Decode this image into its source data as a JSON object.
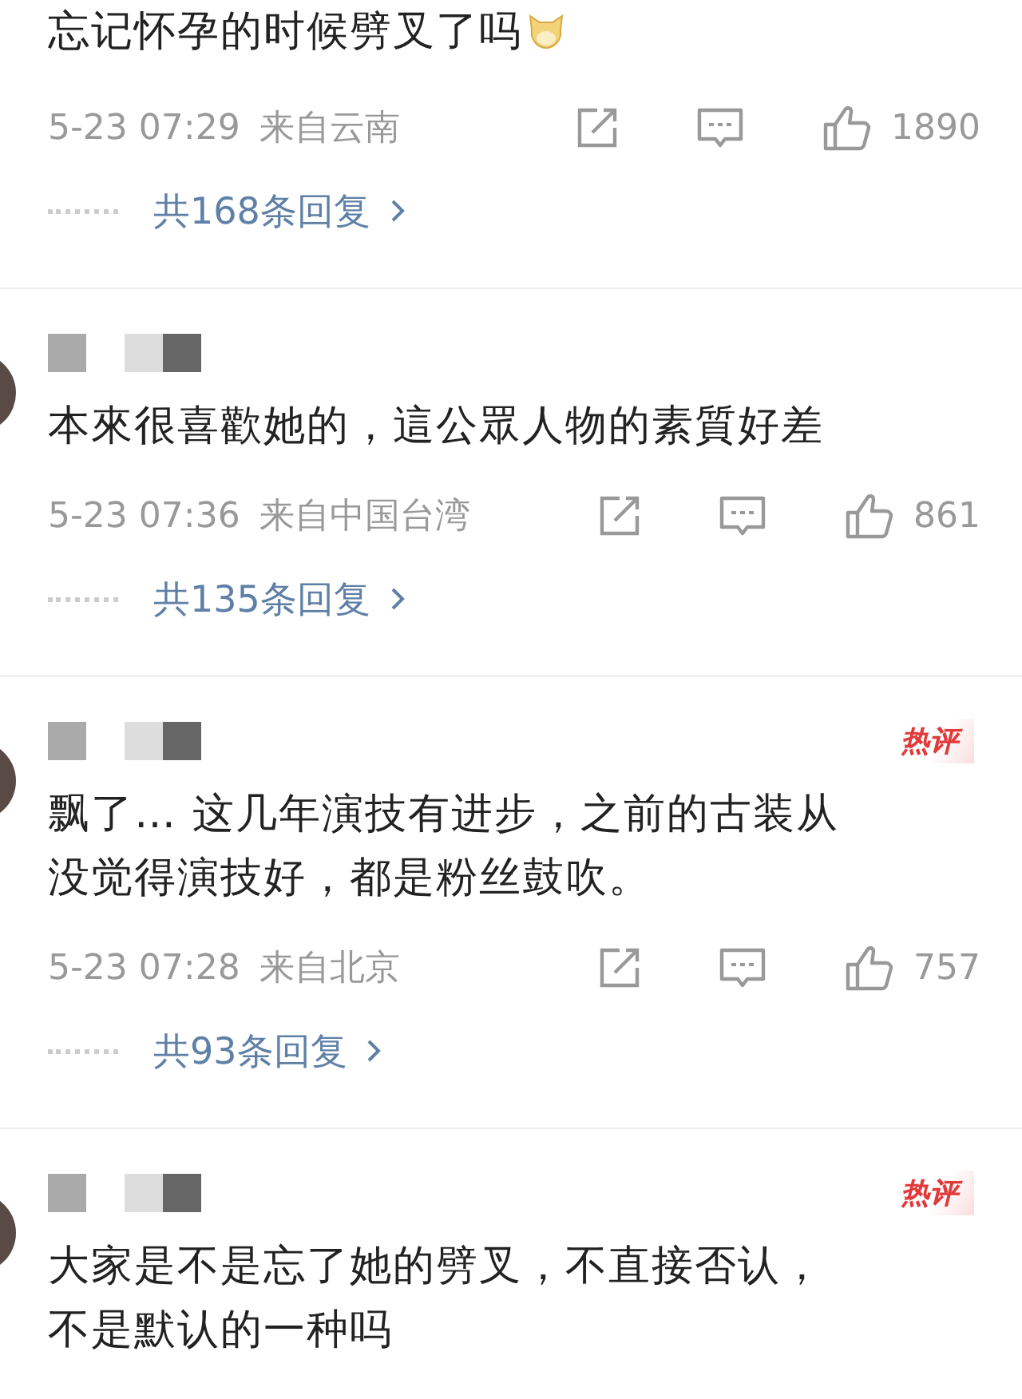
{
  "comments": [
    {
      "username_blurred": false,
      "avatar": false,
      "hot": false,
      "text_lines": [
        "忘记怀孕的时候劈叉了吗"
      ],
      "emoji": true,
      "time": "5-23 07:29",
      "location": "来自云南",
      "likes": "1890",
      "replies": "共168条回复"
    },
    {
      "username_blurred": true,
      "avatar": true,
      "hot": false,
      "text_lines": [
        "本來很喜歡她的，這公眾人物的素質好差"
      ],
      "emoji": false,
      "time": "5-23 07:36",
      "location": "来自中国台湾",
      "likes": "861",
      "replies": "共135条回复"
    },
    {
      "username_blurred": true,
      "avatar": true,
      "hot": true,
      "badge": "热评",
      "text_lines": [
        "飘了… 这几年演技有进步，之前的古装从",
        "没觉得演技好，都是粉丝鼓吹。"
      ],
      "emoji": false,
      "time": "5-23 07:28",
      "location": "来自北京",
      "likes": "757",
      "replies": "共93条回复"
    },
    {
      "username_blurred": true,
      "avatar": true,
      "hot": true,
      "badge": "热评",
      "text_lines": [
        "大家是不是忘了她的劈叉，不直接否认，",
        "不是默认的一种吗"
      ],
      "emoji": false
    }
  ]
}
